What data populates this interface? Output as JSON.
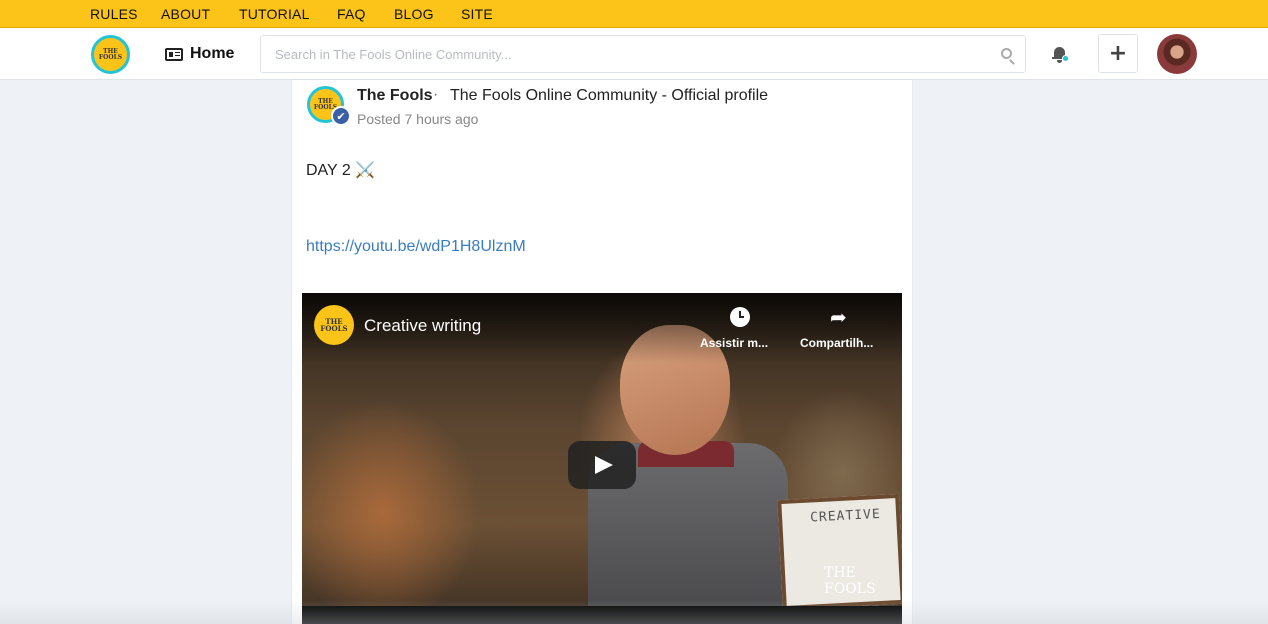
{
  "topnav": [
    "RULES",
    "ABOUT",
    "TUTORIAL",
    "FAQ",
    "BLOG",
    "SITE"
  ],
  "header": {
    "logo_text": "THE FOOLS",
    "home_label": "Home",
    "search_placeholder": "Search in The Fools Online Community...",
    "icons": [
      "search-icon",
      "bell-icon",
      "plus-icon"
    ],
    "plus_label": "+"
  },
  "post": {
    "author": "The Fools",
    "separator": "·",
    "community": "The Fools Online Community - Official profile",
    "posted": "Posted 7 hours ago",
    "text": "DAY 2 ⚔️",
    "link": "https://youtu.be/wdP1H8UlznM",
    "verified_icon": "✔",
    "video": {
      "channel_logo_text": "THE FOOLS",
      "title": "Creative writing",
      "watch_label": "Assistir m...",
      "share_label": "Compartilh...",
      "share_icon": "➦",
      "board_text": "CREATIVE",
      "watermark": "THE FOOLS"
    }
  },
  "colors": {
    "accent_yellow": "#fcc419",
    "accent_teal": "#22c4d6",
    "link_blue": "#3a7cc2",
    "verified_blue": "#3b5ea8"
  }
}
